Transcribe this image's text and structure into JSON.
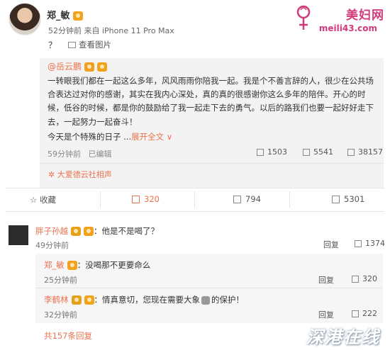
{
  "post": {
    "author": "郑_敏",
    "meta": "52分钟前 来自 iPhone 11 Pro Max",
    "text": "？",
    "view_image": "查看图片"
  },
  "watermark_top": {
    "name": "美妇网",
    "url": "meili43.com"
  },
  "repost": {
    "author": "@岳云鹏",
    "body": "一转眼我们都在一起这么多年，风风雨雨你陪我一起。我是个不善言辞的人，很少在公共场合表达过对你的感谢，其实在我内心深处，真的真的很感谢你这么多年的陪伴。开心的时候，低谷的时候，都是你的鼓励给了我一起走下去的勇气。以后的路我们也要一起好好走下去，一起努力一起奋斗！",
    "line2": "今天是个特殊的日子 ...",
    "expand": "展开全文 ∨",
    "time": "59分钟前",
    "edited": "已编辑",
    "reposts": "1503",
    "comments": "5541",
    "likes": "38157",
    "topic": "大爱德云社相声"
  },
  "actions": {
    "fav": "收藏",
    "repost": "320",
    "comment": "794",
    "like": "5301"
  },
  "comments": [
    {
      "name": "胖子孙越",
      "text": "：他是不是喝了？",
      "time": "49分钟前",
      "reply": "回复",
      "likes": "1374"
    },
    {
      "name": "郑_敏",
      "text": "：没喝那不更要命么",
      "time": "25分钟前",
      "reply": "回复",
      "likes": "320"
    },
    {
      "name": "李鹤林",
      "text_a": "：情真意切，您现在需要大象",
      "text_b": "的保护！",
      "time": "32分钟前",
      "reply": "回复",
      "likes": "222"
    }
  ],
  "more_replies": "共157条回复",
  "watermark_bottom": "深港在线",
  "colors": {
    "accent": "#eb7350",
    "brand_pink": "#d23b7a"
  }
}
